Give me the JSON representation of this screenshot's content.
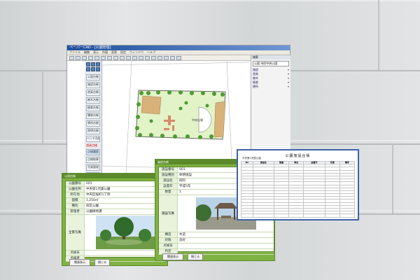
{
  "cad_window": {
    "title": "ペーパーCAD - [公園管理]",
    "menu": [
      "ファイル",
      "編集",
      "表示",
      "作図",
      "変更",
      "設定",
      "ウィンドウ",
      "ヘルプ"
    ],
    "side_buttons": [
      "公園台帳",
      "施設台帳",
      "遊具台帳",
      "樹木台帳",
      "植栽台帳",
      "舗装台帳",
      "便所台帳",
      "照明台帳",
      "ベンチ台帳"
    ],
    "side_label": "遊具点検",
    "side_sub_buttons": [
      "点検履歴",
      "点検結果",
      "写真管理",
      "図面出力",
      "帳票印刷",
      "集計表示",
      "設定"
    ],
    "right_panel": {
      "title": "検索",
      "input_label": "公園",
      "input_value": "市民中央公園",
      "items": [
        "施設",
        "遊具",
        "樹木",
        "植栽",
        "便所"
      ]
    },
    "canvas": {
      "park_label": "中央広場"
    }
  },
  "dialog_left": {
    "title": "公園台帳",
    "fields": [
      {
        "k": "公園番号",
        "v": "001"
      },
      {
        "k": "公園名称",
        "v": "中央第1児童公園"
      },
      {
        "k": "所在地",
        "v": "中央区桜町1丁目"
      },
      {
        "k": "面積",
        "v": "1,250㎡"
      },
      {
        "k": "種別",
        "v": "街区公園"
      },
      {
        "k": "管理者",
        "v": "公園緑地課"
      },
      {
        "k": "開設日",
        "v": "昭和58年4月1日"
      },
      {
        "k": "備考",
        "v": "遊具点検済"
      }
    ],
    "photo_label": "全景写真",
    "bottom_fields": [
      {
        "k": "点検日",
        "v": ""
      },
      {
        "k": "点検者",
        "v": ""
      },
      {
        "k": "判定",
        "v": ""
      }
    ],
    "buttons": [
      "関連表示",
      "閉じる"
    ]
  },
  "dialog_right": {
    "title": "施設台帳",
    "fields": [
      {
        "k": "施設番号",
        "v": "001"
      },
      {
        "k": "施設種別",
        "v": "休憩施設"
      },
      {
        "k": "施設名",
        "v": "四阿"
      },
      {
        "k": "設置年",
        "v": "平成5年"
      },
      {
        "k": "数量",
        "v": "1"
      },
      {
        "k": "構造",
        "v": "木造"
      },
      {
        "k": "状態",
        "v": "良好"
      }
    ],
    "photo_label": "施設写真",
    "bottom_fields": [
      {
        "k": "点検日",
        "v": ""
      },
      {
        "k": "判定",
        "v": ""
      }
    ],
    "buttons": [
      "関連表示",
      "閉じる"
    ]
  },
  "report": {
    "title": "公園施設台帳",
    "subtitle": "中央第1児童公園",
    "headers": [
      "No",
      "施設名",
      "数量",
      "単位",
      "設置年",
      "状態",
      "備考"
    ],
    "row_count": 18
  },
  "colors": {
    "dialog_green": "#7fb241",
    "report_border": "#3d63a8",
    "titlebar_blue": "#1e4e9a"
  }
}
